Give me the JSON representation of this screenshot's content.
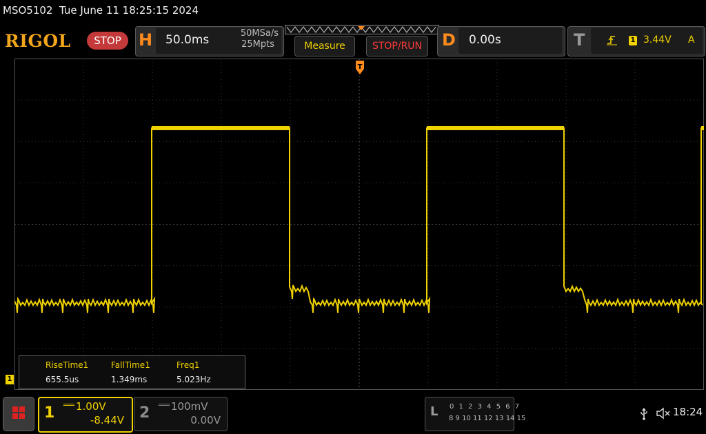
{
  "status": {
    "model": "MSO5102",
    "datetime": "Tue June 11 18:25:15 2024"
  },
  "header": {
    "logo": "RIGOL",
    "run_state": "STOP",
    "horizontal": {
      "letter": "H",
      "timebase": "50.0ms",
      "sample_rate": "50MSa/s",
      "memory_depth": "25Mpts"
    },
    "measure_label": "Measure",
    "stop_run_label": "STOP/RUN",
    "delay": {
      "letter": "D",
      "value": "0.00s"
    },
    "trigger": {
      "letter": "T",
      "source": "1",
      "level": "3.44V",
      "mode": "A",
      "edge_icon": "rising-edge-icon"
    }
  },
  "measurements": {
    "channel_tab": "1",
    "items": [
      {
        "label": "RiseTime1",
        "value": "655.5us"
      },
      {
        "label": "FallTime1",
        "value": "1.349ms"
      },
      {
        "label": "Freq1",
        "value": "5.023Hz"
      }
    ]
  },
  "channels": [
    {
      "number": "1",
      "scale": "1.00V",
      "offset": "-8.44V",
      "active": true
    },
    {
      "number": "2",
      "scale": "100mV",
      "offset": "0.00V",
      "active": false
    }
  ],
  "logic_analyzer": {
    "letter": "L",
    "row1": "0 1 2 3  4 5 6 7",
    "row2": "8 9 10 11 12 13 14 15"
  },
  "system": {
    "time": "18:24"
  },
  "colors": {
    "ch1": "#f0d200",
    "accent": "#ff8a1e",
    "stop": "#c43a3a"
  },
  "waveform": {
    "channel": "1",
    "levels": [
      "low",
      "high",
      "low",
      "high",
      "low",
      "high"
    ],
    "frequency_hz": 5.023
  }
}
